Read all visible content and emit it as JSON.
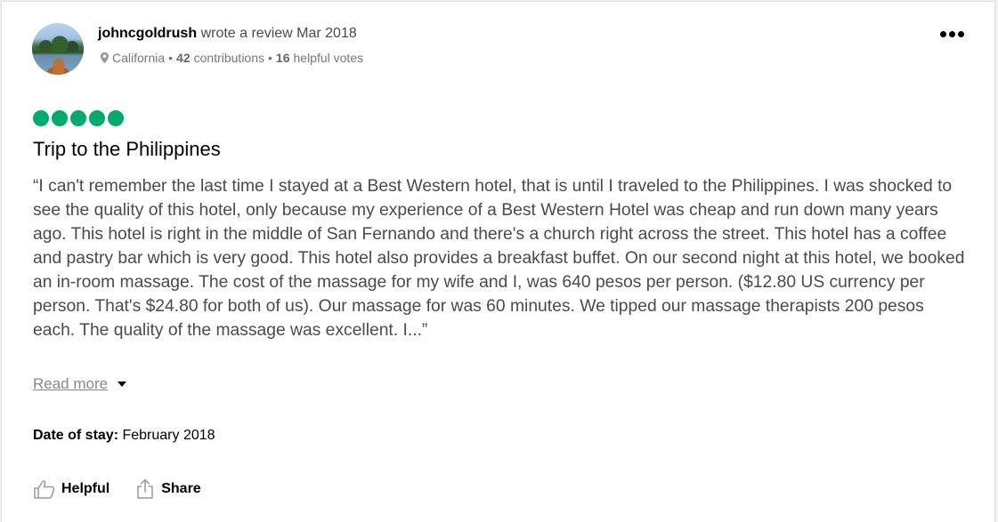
{
  "review": {
    "username": "johncgoldrush",
    "wrote_text": "wrote a review Mar 2018",
    "location": "California",
    "separator": "•",
    "contributions_count": "42",
    "contributions_label": "contributions",
    "helpful_count": "16",
    "helpful_label": "helpful votes",
    "rating": 5,
    "rating_color": "#00aa6c",
    "title": "Trip to the Philippines",
    "body": "“I can't remember the last time I stayed at a Best Western hotel, that is until I traveled to the Philippines. I was shocked to see the quality of this hotel, only because my experience of a Best Western Hotel was cheap and run down many years ago. This hotel is right in the middle of San Fernando and there's a church right across the street. This hotel has a coffee and pastry bar which is very good. This hotel also provides a breakfast buffet. On our second night at this hotel, we booked an in-room massage. The cost of the massage for my wife and I, was 640 pesos per person. ($12.80 US currency per person. That's $24.80 for both of us). Our massage for was 60 minutes. We tipped our massage therapists 200 pesos each. The quality of the massage was excellent. I...”",
    "read_more": "Read more",
    "date_of_stay_label": "Date of stay:",
    "date_of_stay": "February 2018",
    "helpful_button": "Helpful",
    "share_button": "Share"
  },
  "icons": {
    "more": "more-options-icon",
    "location": "location-pin-icon",
    "thumbs_up": "thumbs-up-icon",
    "share": "share-icon",
    "caret": "chevron-down-icon"
  }
}
